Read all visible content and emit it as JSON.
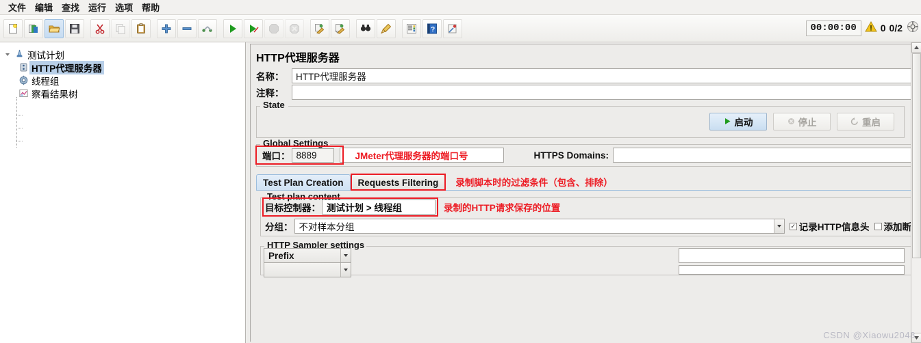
{
  "window": {
    "watermark": "CSDN @Xiaowu2048"
  },
  "menubar": {
    "items": [
      {
        "label": "文件",
        "name": "menu-file"
      },
      {
        "label": "编辑",
        "name": "menu-edit"
      },
      {
        "label": "查找",
        "name": "menu-search"
      },
      {
        "label": "运行",
        "name": "menu-run"
      },
      {
        "label": "选项",
        "name": "menu-options"
      },
      {
        "label": "帮助",
        "name": "menu-help"
      }
    ]
  },
  "toolbar": {
    "buttons": [
      {
        "icon": "new-file-icon",
        "state": "normal"
      },
      {
        "icon": "templates-icon",
        "state": "normal"
      },
      {
        "icon": "open-folder-icon",
        "state": "selected"
      },
      {
        "icon": "save-icon",
        "state": "normal"
      },
      {
        "icon": "cut-icon",
        "state": "normal"
      },
      {
        "icon": "copy-icon",
        "state": "disabled"
      },
      {
        "icon": "paste-icon",
        "state": "normal"
      },
      {
        "icon": "expand-all-icon",
        "state": "normal"
      },
      {
        "icon": "collapse-all-icon",
        "state": "normal"
      },
      {
        "icon": "toggle-icon",
        "state": "normal"
      },
      {
        "icon": "start-icon",
        "state": "normal"
      },
      {
        "icon": "start-no-pauses-icon",
        "state": "normal"
      },
      {
        "icon": "stop-icon",
        "state": "disabled"
      },
      {
        "icon": "shutdown-icon",
        "state": "disabled"
      },
      {
        "icon": "clear-icon",
        "state": "normal"
      },
      {
        "icon": "clear-all-icon",
        "state": "normal"
      },
      {
        "icon": "search-icon",
        "state": "normal"
      },
      {
        "icon": "reset-search-icon",
        "state": "normal"
      },
      {
        "icon": "function-helper-icon",
        "state": "normal"
      },
      {
        "icon": "help-icon",
        "state": "normal"
      },
      {
        "icon": "undo-icon",
        "state": "normal"
      }
    ],
    "timer": "00:00:00",
    "error_count": "0",
    "thread_count": "0/2",
    "warning_icon": "warning-triangle-icon",
    "remote_icon": "connect-icon"
  },
  "tree": {
    "nodes": [
      {
        "label": "测试计划",
        "icon": "test-plan-icon",
        "selected": false,
        "depth": 0
      },
      {
        "label": "HTTP代理服务器",
        "icon": "proxy-server-icon",
        "selected": true,
        "depth": 1
      },
      {
        "label": "线程组",
        "icon": "thread-group-icon",
        "selected": false,
        "depth": 1
      },
      {
        "label": "察看结果树",
        "icon": "view-results-tree-icon",
        "selected": false,
        "depth": 1
      }
    ]
  },
  "panel": {
    "title": "HTTP代理服务器",
    "name_label": "名称：",
    "name_value": "HTTP代理服务器",
    "comment_label": "注释：",
    "comment_value": "",
    "state": {
      "legend": "State",
      "start_label": "启动",
      "stop_label": "停止",
      "restart_label": "重启"
    },
    "global_settings": {
      "legend": "Global Settings",
      "port_label": "端口：",
      "port_value": "8889",
      "port_annotation": "JMeter代理服务器的端口号",
      "https_domains_label": "HTTPS Domains:",
      "https_domains_value": ""
    },
    "tabs": [
      {
        "label": "Test Plan Creation",
        "active": true
      },
      {
        "label": "Requests Filtering",
        "active": false
      }
    ],
    "tabs_annotation": "录制脚本时的过滤条件（包含、排除）",
    "test_plan_content": {
      "legend": "Test plan content",
      "target_controller_label": "目标控制器：",
      "target_controller_value": "测试计划 > 线程组",
      "target_controller_annotation": "录制的HTTP请求保存的位置",
      "grouping_label": "分组：",
      "grouping_value": "不对样本分组",
      "capture_headers_label": "记录HTTP信息头",
      "capture_headers_checked": true,
      "add_assertions_label": "添加断",
      "add_assertions_checked": false
    },
    "http_sampler_settings": {
      "legend": "HTTP Sampler settings",
      "prefix_label": "Prefix",
      "prefix_value": ""
    }
  }
}
